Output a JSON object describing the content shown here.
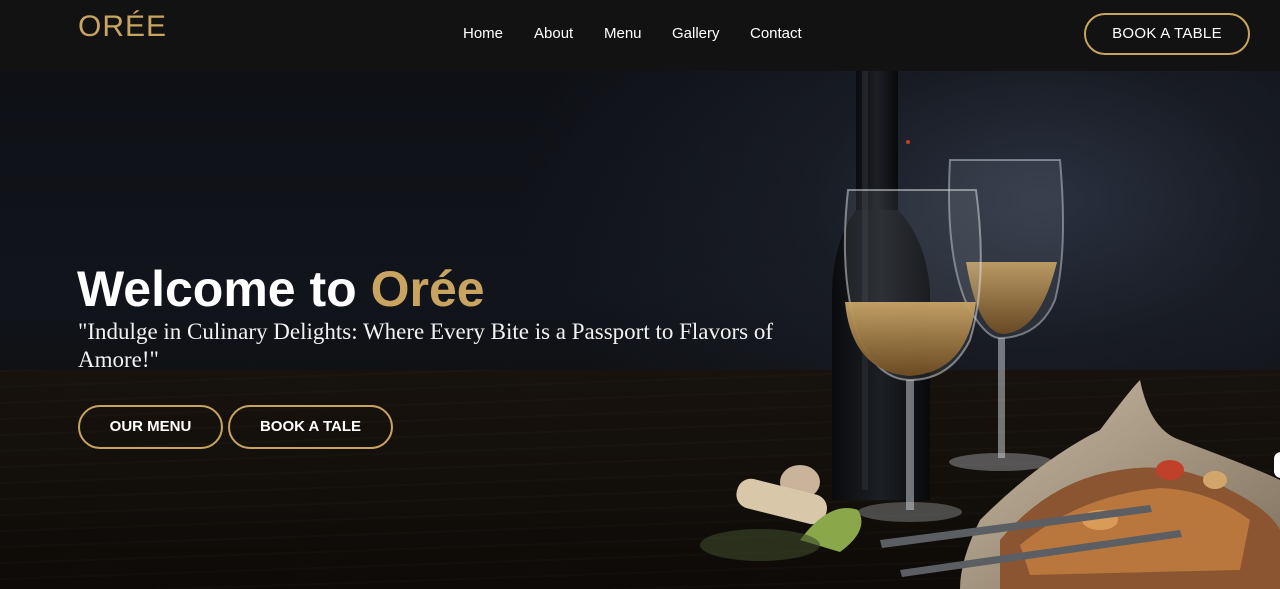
{
  "brand": {
    "logo": "ORÉE"
  },
  "nav": {
    "items": [
      {
        "label": "Home"
      },
      {
        "label": "About"
      },
      {
        "label": "Menu"
      },
      {
        "label": "Gallery"
      },
      {
        "label": "Contact"
      }
    ],
    "book_button": "BOOK A TABLE"
  },
  "hero": {
    "title_prefix": "Welcome to ",
    "title_accent": "Orée",
    "tagline": "\"Indulge in Culinary Delights: Where Every Bite is a Passport to Flavors of Amore!\"",
    "buttons": {
      "menu": "OUR MENU",
      "book": "BOOK A TALE"
    }
  },
  "colors": {
    "accent": "#c9a461",
    "navbar_bg": "#121212",
    "hero_bg": "#0d0f14",
    "text": "#ffffff"
  },
  "icons": [
    "wine-bottle-illustration",
    "wine-glass-illustration",
    "food-platter-illustration"
  ]
}
